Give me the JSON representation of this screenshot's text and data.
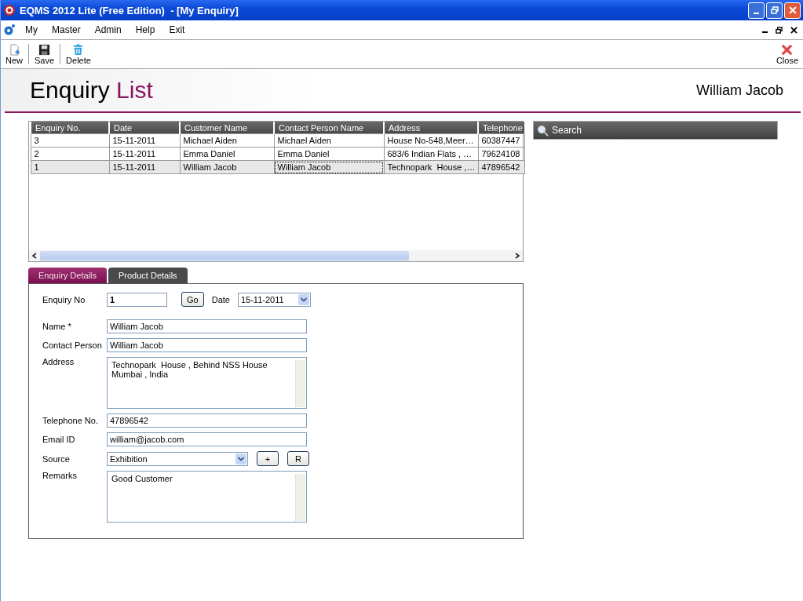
{
  "window": {
    "title": "EQMS 2012 Lite (Free Edition)  - [My Enquiry]"
  },
  "menu": [
    "My",
    "Master",
    "Admin",
    "Help",
    "Exit"
  ],
  "toolbar": [
    {
      "label": "New",
      "kind": "new"
    },
    {
      "label": "Save",
      "kind": "save"
    },
    {
      "label": "Delete",
      "kind": "delete"
    }
  ],
  "close_button": "Close",
  "header": {
    "title_first": "Enquiry",
    "title_second": "List",
    "user": "William Jacob"
  },
  "table": {
    "columns": [
      "Enquiry No.",
      "Date",
      "Customer Name",
      "Contact Person Name",
      "Address",
      "Telephone"
    ],
    "rows": [
      {
        "cells": [
          "3",
          "15-11-2011",
          "Michael Aiden",
          "Michael Aiden",
          "House No-548,Meer…",
          "60387447"
        ],
        "selected": false
      },
      {
        "cells": [
          "2",
          "15-11-2011",
          "Emma Daniel",
          "Emma Daniel",
          "683/6 Indian Flats , …",
          "79624108"
        ],
        "selected": false
      },
      {
        "cells": [
          "1",
          "15-11-2011",
          "William Jacob",
          "William Jacob",
          "Technopark  House ,…",
          "47896542"
        ],
        "selected": true
      }
    ]
  },
  "search": {
    "label": "Search"
  },
  "tabs": [
    {
      "label": "Enquiry Details",
      "selected": true
    },
    {
      "label": "Product Details",
      "selected": false
    }
  ],
  "form": {
    "enquiry_no": {
      "label": "Enquiry No",
      "value": "1"
    },
    "go_button": "Go",
    "date": {
      "label": "Date",
      "value": "15-11-2011"
    },
    "fields": [
      {
        "kind": "text",
        "label": "Name *",
        "value": "William Jacob"
      },
      {
        "kind": "text",
        "label": "Contact Person",
        "value": "William Jacob"
      },
      {
        "kind": "textarea",
        "label": "Address",
        "value": "Technopark  House , Behind NSS House\nMumbai , India"
      },
      {
        "kind": "text",
        "label": "Telephone No.",
        "value": "47896542"
      },
      {
        "kind": "text",
        "label": "Email ID",
        "value": "william@jacob.com"
      },
      {
        "kind": "select",
        "label": "Source",
        "value": "Exhibition",
        "buttons": [
          "+",
          "R"
        ]
      },
      {
        "kind": "textarea",
        "label": "Remarks",
        "value": "Good Customer"
      }
    ]
  }
}
